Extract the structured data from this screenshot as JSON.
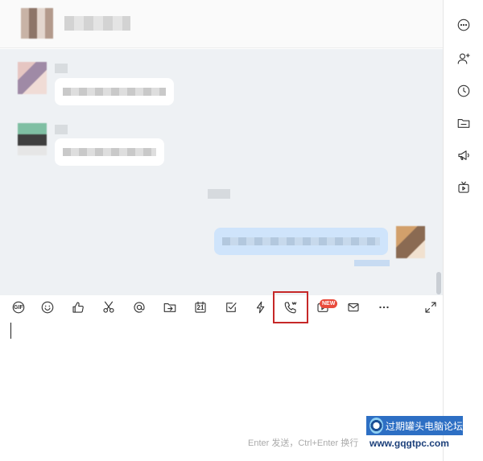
{
  "toolbar": {
    "gif_label": "GIF",
    "calendar_day": "21",
    "new_badge": "NEW"
  },
  "input": {
    "hint": "Enter 发送，Ctrl+Enter 换行"
  },
  "watermark": {
    "title": "过期罐头电脑论坛",
    "url": "www.gqgtpc.com"
  },
  "icons": {
    "toolbar": [
      "gif-icon",
      "emoji-icon",
      "thumbs-up-icon",
      "scissors-icon",
      "at-icon",
      "folder-share-icon",
      "calendar-icon",
      "checkbox-icon",
      "lightning-icon",
      "phone-call-icon",
      "video-play-icon",
      "mail-icon",
      "more-icon",
      "expand-icon"
    ],
    "sidebar": [
      "more-options-icon",
      "add-user-icon",
      "history-icon",
      "folder-icon",
      "announcement-icon",
      "tv-icon"
    ]
  },
  "colors": {
    "highlight_border": "#c62828",
    "chat_background": "#eef1f4",
    "own_bubble": "#cfe4fb",
    "badge": "#e94b3c"
  }
}
